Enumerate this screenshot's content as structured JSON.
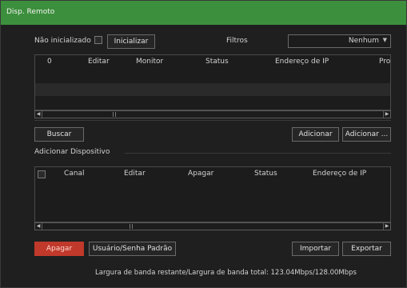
{
  "window": {
    "title": "Disp. Remoto"
  },
  "top_controls": {
    "uninitialized_label": "Não inicializado",
    "initialize_button": "Inicializar",
    "filters_label": "Filtros",
    "filters_select": {
      "value": "Nenhum"
    }
  },
  "found_table": {
    "headers": [
      "0",
      "Editar",
      "Monitor",
      "Status",
      "Endereço de IP",
      "Pro"
    ],
    "rows": []
  },
  "buttons_mid": {
    "search": "Buscar",
    "add": "Adicionar",
    "add_manual": "Adicionar ..."
  },
  "added_section": {
    "title": "Adicionar Dispositivo"
  },
  "added_table": {
    "headers": [
      "Canal",
      "Editar",
      "Apagar",
      "Status",
      "Endereço de IP"
    ],
    "rows": []
  },
  "buttons_bottom": {
    "delete": "Apagar",
    "default_credentials": "Usuário/Senha Padrão",
    "import": "Importar",
    "export": "Exportar"
  },
  "bandwidth": {
    "text": "Largura de banda restante/Largura de banda total: 123.04Mbps/128.00Mbps"
  },
  "colors": {
    "accent": "#3c8f3c",
    "danger": "#c0392b",
    "background": "#1f1f1f"
  }
}
